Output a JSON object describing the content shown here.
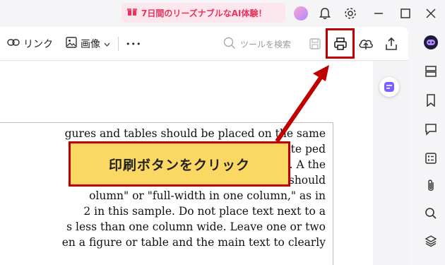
{
  "titlebar": {
    "promo_text": "7日間のリーズナブルなAI体験！",
    "icons": [
      "gift-icon",
      "avatar",
      "bell-icon",
      "gear-icon",
      "minimize-icon",
      "maximize-icon",
      "close-icon"
    ]
  },
  "toolbar": {
    "link_label": "リンク",
    "image_label": "画像",
    "more_label": "•••",
    "search_placeholder": "ツールを検索",
    "icons": [
      "link-icon",
      "image-icon",
      "chevron-down-icon",
      "search-icon",
      "save-icon",
      "print-icon",
      "cloud-upload-icon",
      "share-icon"
    ]
  },
  "document": {
    "lines": [
      "gures and tables should be placed on the same",
      "t first cite                                              ped",
      "nuscript. A                                               the",
      "ch page. The width of a figure or table should",
      "olumn\" or \"full-width in one column,\" as in",
      " 2 in this sample. Do not place text next to a",
      "s less than one column wide. Leave one or two",
      "en a figure or table and the main text to clearly"
    ]
  },
  "callout": {
    "text": "印刷ボタンをクリック",
    "color": "#fbd764",
    "border_color": "#c00000"
  },
  "sidebar": {
    "icons": [
      "ai-assistant-icon",
      "panels-icon",
      "bookmark-icon",
      "comment-icon",
      "form-icon",
      "attachment-icon",
      "search-icon",
      "layers-icon"
    ]
  },
  "colors": {
    "accent_red": "#c00000",
    "promo_pink": "#e8335a"
  }
}
